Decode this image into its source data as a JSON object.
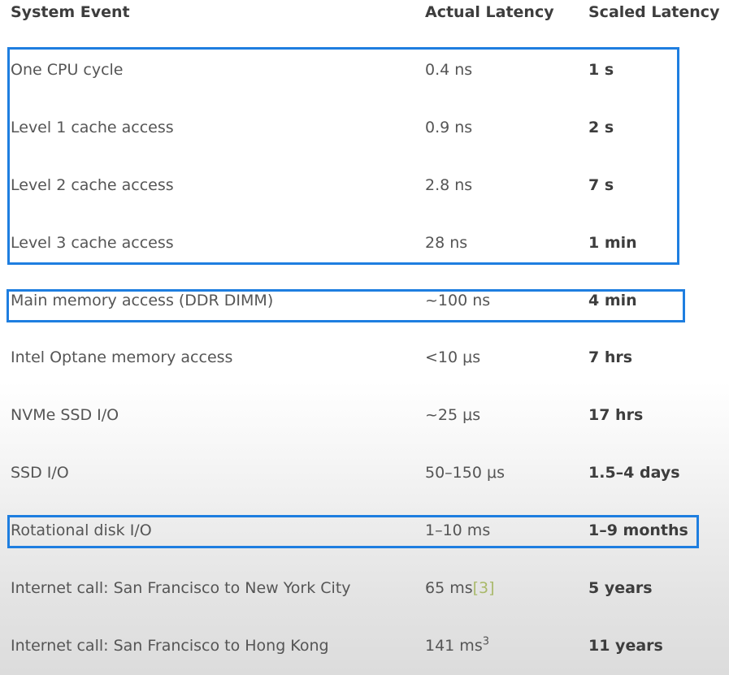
{
  "headers": {
    "event": "System Event",
    "actual": "Actual Latency",
    "scaled": "Scaled Latency"
  },
  "rows": [
    {
      "event": "One CPU cycle",
      "actual": "0.4 ns",
      "scaled": "1 s"
    },
    {
      "event": "Level 1 cache access",
      "actual": "0.9 ns",
      "scaled": "2 s"
    },
    {
      "event": "Level 2 cache access",
      "actual": "2.8 ns",
      "scaled": "7 s"
    },
    {
      "event": "Level 3 cache access",
      "actual": "28 ns",
      "scaled": "1 min"
    },
    {
      "event": "Main memory access (DDR DIMM)",
      "actual": "~100 ns",
      "scaled": "4 min"
    },
    {
      "event": "Intel Optane memory access",
      "actual": "<10 μs",
      "scaled": "7 hrs"
    },
    {
      "event": "NVMe SSD I/O",
      "actual": "~25 μs",
      "scaled": "17 hrs"
    },
    {
      "event": "SSD I/O",
      "actual": "50–150 μs",
      "scaled": "1.5–4 days"
    },
    {
      "event": "Rotational disk I/O",
      "actual": "1–10 ms",
      "scaled": "1–9 months"
    },
    {
      "event": "Internet call: San Francisco to New York City",
      "actual": "65 ms",
      "actual_cite": "[3]",
      "scaled": "5 years"
    },
    {
      "event": "Internet call: San Francisco to Hong Kong",
      "actual": "141 ms",
      "actual_sup": "3",
      "scaled": "11 years"
    }
  ],
  "highlight_color": "#1e7ee0",
  "citation_color": "#a9b96a"
}
